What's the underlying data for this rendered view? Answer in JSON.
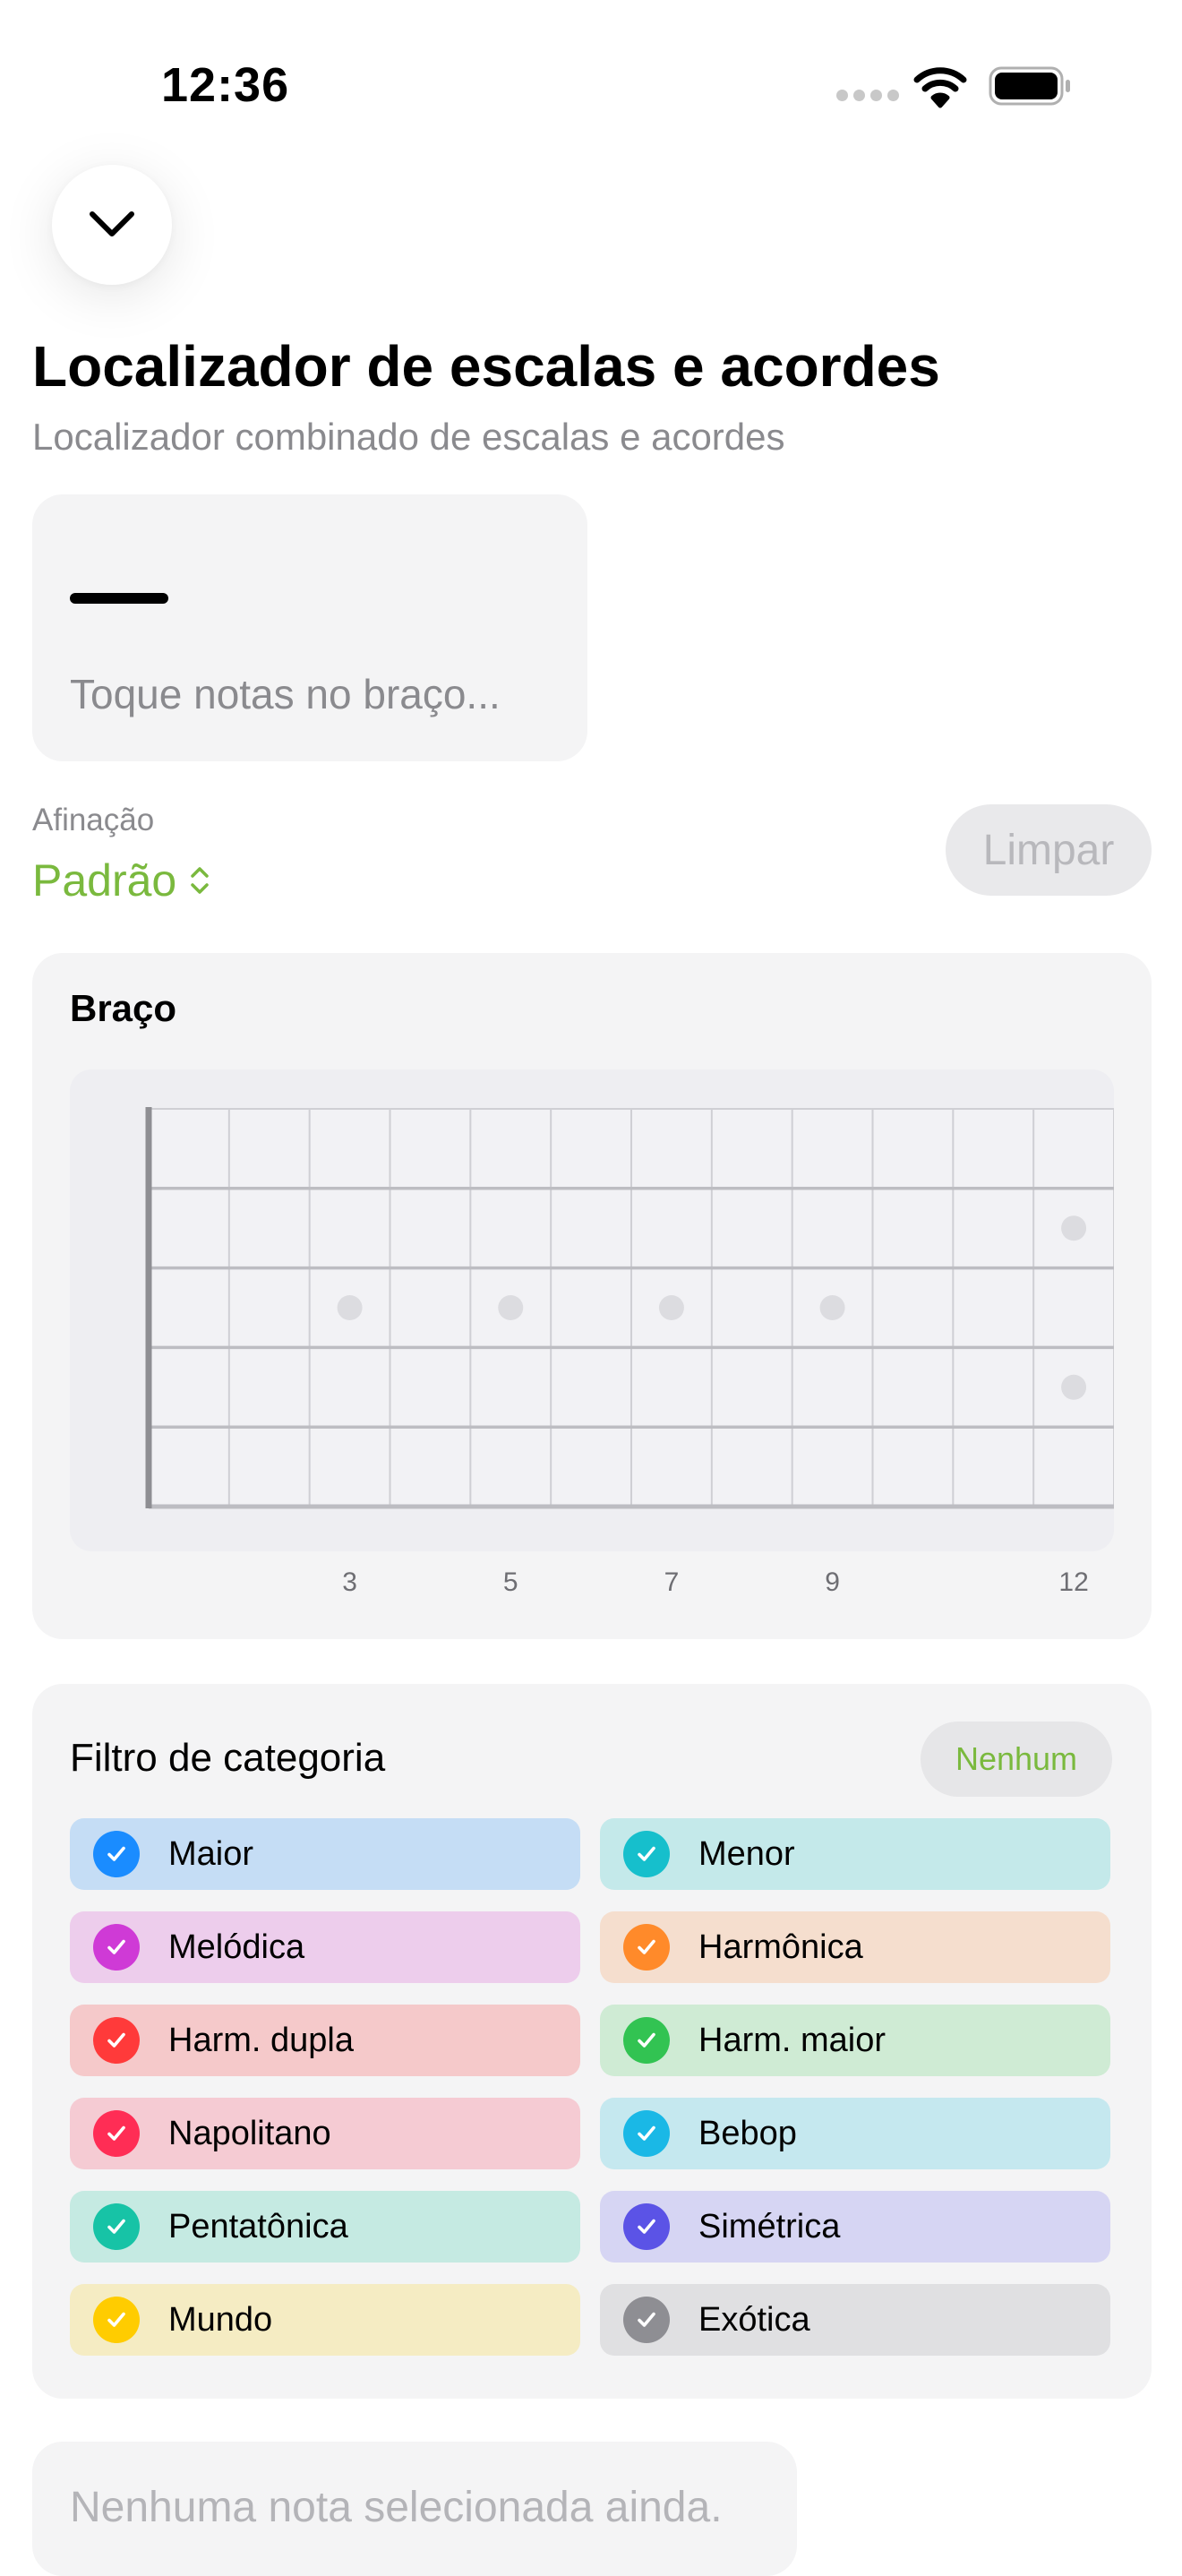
{
  "status_bar": {
    "time": "12:36"
  },
  "header": {
    "title": "Localizador de escalas e acordes",
    "subtitle": "Localizador combinado de escalas e acordes"
  },
  "notes_panel": {
    "placeholder": "Toque notas no braço..."
  },
  "tuning": {
    "label": "Afinação",
    "value": "Padrão"
  },
  "actions": {
    "clear_label": "Limpar"
  },
  "fretboard": {
    "title": "Braço",
    "strings": 6,
    "frets": 12,
    "markers": [
      "3",
      "5",
      "7",
      "9",
      "12"
    ]
  },
  "category_filter": {
    "title": "Filtro de categoria",
    "none_label": "Nenhum",
    "categories": [
      {
        "label": "Maior",
        "color": "#1a8cff",
        "bg": "#c5ddf5",
        "checked": true
      },
      {
        "label": "Menor",
        "color": "#16bfcc",
        "bg": "#c4e9ea",
        "checked": true
      },
      {
        "label": "Melódica",
        "color": "#cf3ad6",
        "bg": "#edcdec",
        "checked": true
      },
      {
        "label": "Harmônica",
        "color": "#ff8a2a",
        "bg": "#f5dece",
        "checked": true
      },
      {
        "label": "Harm. dupla",
        "color": "#ff3a3a",
        "bg": "#f5c9ca",
        "checked": true
      },
      {
        "label": "Harm. maior",
        "color": "#32c352",
        "bg": "#cfebd4",
        "checked": true
      },
      {
        "label": "Napolitano",
        "color": "#ff2d55",
        "bg": "#f5cbd3",
        "checked": true
      },
      {
        "label": "Bebop",
        "color": "#1ab8e6",
        "bg": "#c5e8ef",
        "checked": true
      },
      {
        "label": "Pentatônica",
        "color": "#17c3a6",
        "bg": "#c5eae2",
        "checked": true
      },
      {
        "label": "Simétrica",
        "color": "#5b53e6",
        "bg": "#d6d5f3",
        "checked": true
      },
      {
        "label": "Mundo",
        "color": "#ffcc00",
        "bg": "#f5ecc3",
        "checked": true
      },
      {
        "label": "Exótica",
        "color": "#8e8e93",
        "bg": "#e0e0e2",
        "checked": true
      }
    ]
  },
  "results": {
    "empty_text": "Nenhuma nota selecionada ainda."
  }
}
